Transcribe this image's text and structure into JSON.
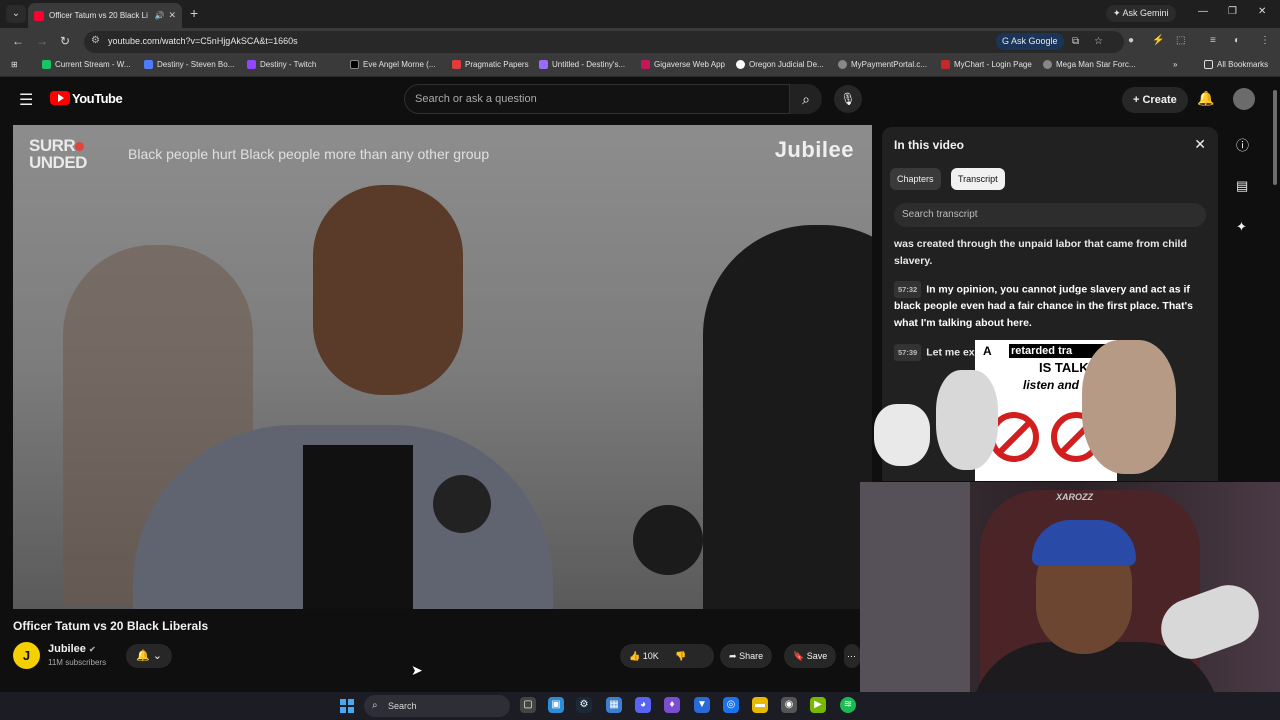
{
  "browser": {
    "tab_title": "Officer Tatum vs 20 Black Li",
    "tab_close": "✕",
    "new_tab": "+",
    "ask_gemini": "Ask Gemini",
    "url": "youtube.com/watch?v=C5nHjgAkSCA&t=1660s",
    "ask_google": "Ask Google",
    "bookmarks": [
      {
        "label": "Current Stream - W...",
        "color": "#19c463"
      },
      {
        "label": "Destiny - Steven Bo...",
        "color": "#4d7cfe"
      },
      {
        "label": "Destiny - Twitch",
        "color": "#9146ff"
      },
      {
        "label": "Eve Angel Morne (...",
        "color": "#111111"
      },
      {
        "label": "Pragmatic Papers",
        "color": "#e23b3b"
      },
      {
        "label": "Untitled - Destiny's...",
        "color": "#9a6bff"
      },
      {
        "label": "Gigaverse Web App",
        "color": "#c2185b"
      },
      {
        "label": "Oregon Judicial De...",
        "color": "#ffffff"
      },
      {
        "label": "MyPaymentPortal.c...",
        "color": "#888888"
      },
      {
        "label": "MyChart - Login Page",
        "color": "#c62828"
      },
      {
        "label": "Mega Man Star Forc...",
        "color": "#888888"
      }
    ],
    "all_bookmarks": "All Bookmarks"
  },
  "youtube": {
    "logo_text": "YouTube",
    "search_placeholder": "Search or ask a question",
    "create_label": "Create",
    "video": {
      "brand_top": "SURR",
      "brand_bottom": "UNDED",
      "caption": "Black people hurt Black people more than any other group",
      "watermark": "Jubilee",
      "mic_label": "SURROUNDED",
      "title": "Officer Tatum vs 20 Black Liberals",
      "channel_initial": "J",
      "channel": "Jubilee",
      "subscribers": "11M subscribers",
      "likes": "10K",
      "share": "Share",
      "save": "Save"
    },
    "panel": {
      "title": "In this video",
      "tab_chapters": "Chapters",
      "tab_transcript": "Transcript",
      "search_placeholder": "Search transcript",
      "segments": [
        {
          "time": "",
          "text": "was created through the unpaid labor that came from child slavery."
        },
        {
          "time": "57:32",
          "text": "In my opinion, you cannot judge slavery and act as if black people even had a fair chance in the first place. That's what I'm talking about here."
        },
        {
          "time": "57:39",
          "text": "Let me ex"
        }
      ]
    },
    "sticker": {
      "letter": "A",
      "line1": "retarded tra",
      "line2": "IS TALK",
      "line3": "listen and learn"
    }
  },
  "webcam": {
    "brand": "XAROZZ"
  },
  "taskbar": {
    "search": "Search"
  }
}
